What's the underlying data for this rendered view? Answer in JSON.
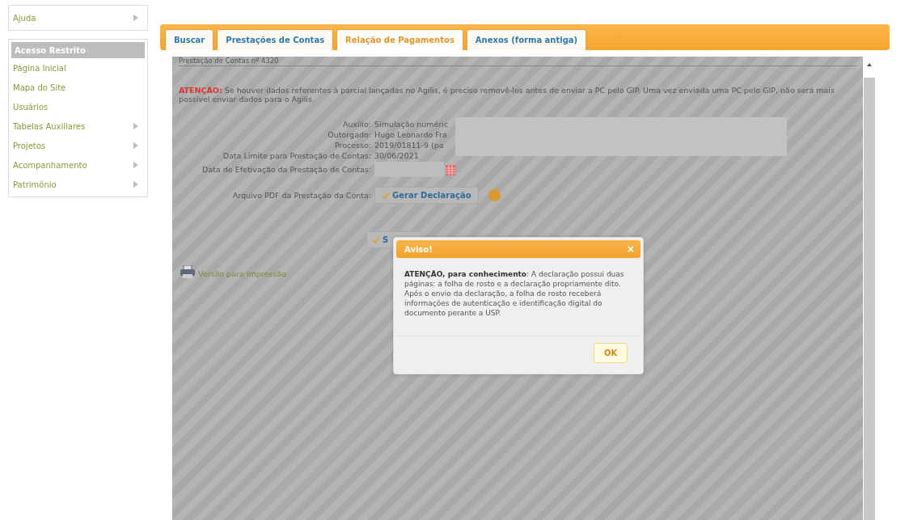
{
  "sidebar": {
    "top_items": [
      {
        "label": "Ajuda",
        "has_submenu": true
      }
    ],
    "section_title": "Acesso Restrito",
    "items": [
      {
        "label": "Página Inicial",
        "has_submenu": false
      },
      {
        "label": "Mapa do Site",
        "has_submenu": false
      },
      {
        "label": "Usuários",
        "has_submenu": false
      },
      {
        "label": "Tabelas Auxiliares",
        "has_submenu": true
      },
      {
        "label": "Projetos",
        "has_submenu": true
      },
      {
        "label": "Acompanhamento",
        "has_submenu": true
      },
      {
        "label": "Patrimônio",
        "has_submenu": true
      }
    ]
  },
  "tabs": [
    {
      "label": "Buscar",
      "selected": false
    },
    {
      "label": "Prestações de Contas",
      "selected": false
    },
    {
      "label": "Relação de Pagamentos",
      "selected": true
    },
    {
      "label": "Anexos (forma antiga)",
      "selected": false
    }
  ],
  "content": {
    "heading": "Prestação de Contas nº 4320",
    "warning": "**ATENÇÃO:** Se houver dados referentes à parcial lançadas no Agilis, é preciso removê-los antes de enviar a PC pelo GIP. Uma vez enviada uma PC pelo GIP, não será mais possível enviar dados para o Agilis.",
    "fields": [
      {
        "label": "Auxílio:",
        "value": "Simulação numéric"
      },
      {
        "label": "Outorgado:",
        "value": "Hugo Leonardo Fra"
      },
      {
        "label": "Processo:",
        "value": "2019/01811-9 (pa"
      },
      {
        "label": "Data Limite para Prestação de Contas:",
        "value": "30/06/2021"
      }
    ],
    "date_field": {
      "label": "Data de Efetivação da Prestação de Contas:"
    },
    "pdf_label": "Arquivo PDF da Prestação da Conta:",
    "generate_button": "Gerar Declaração",
    "submit_button": "S",
    "print_link": "Versão para Impressão"
  },
  "dialog": {
    "title": "Aviso!",
    "close": "×",
    "message": "**ATENÇÃO, para conhecimento**: A declaração possui duas páginas: a folha de rosto e a declaração propriamente dito. Após o envio da declaração, a folha de rosto receberá informações de autenticação e identificação digital do documento perante a USP.",
    "ok": "OK"
  }
}
